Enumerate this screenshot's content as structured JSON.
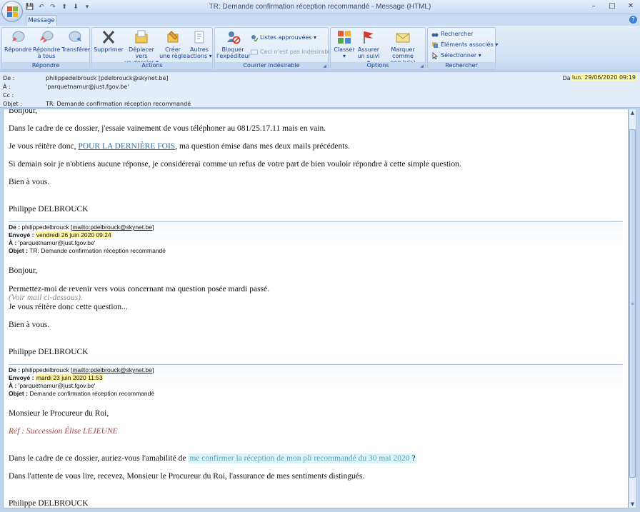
{
  "window": {
    "title": "TR: Demande confirmation réception recommandé - Message (HTML)",
    "minimize": "–",
    "maximize": "□",
    "close": "✕"
  },
  "qat": [
    "💾",
    "↶",
    "↷",
    "⬆",
    "⬇",
    "▾"
  ],
  "tabs": [
    {
      "label": "Message",
      "active": true
    }
  ],
  "ribbon": {
    "groups": {
      "repondre": {
        "label": "Répondre",
        "buttons": [
          {
            "label": "Répondre",
            "label2": ""
          },
          {
            "label": "Répondre",
            "label2": "à tous"
          },
          {
            "label": "Transférer",
            "label2": ""
          }
        ]
      },
      "actions": {
        "label": "Actions",
        "buttons": [
          {
            "label": "Supprimer",
            "label2": ""
          },
          {
            "label": "Déplacer vers",
            "label2": "un dossier ▾"
          },
          {
            "label": "Créer",
            "label2": "une règle"
          },
          {
            "label": "Autres",
            "label2": "actions ▾"
          }
        ]
      },
      "courrier": {
        "label": "Courrier indésirable",
        "bloquer": {
          "label": "Bloquer",
          "label2": "l'expéditeur"
        },
        "listes": "Listes approuvées ▾",
        "pas_indesirable": "Ceci n'est pas indésirable"
      },
      "options": {
        "label": "Options",
        "buttons": [
          {
            "label": "Classer",
            "label2": "▾"
          },
          {
            "label": "Assurer",
            "label2": "un suivi ▾"
          },
          {
            "label": "Marquer comme",
            "label2": "non lu(s)"
          }
        ]
      },
      "rechercher": {
        "label": "Rechercher",
        "items": [
          "Rechercher",
          "Éléments associés ▾",
          "Sélectionner ▾"
        ]
      }
    }
  },
  "header": {
    "from_label": "De :",
    "from_value": "philippedelbrouck [pdelbrouck@skynet.be]",
    "to_label": "À :",
    "to_value": "'parquetnamur@just.fgov.be'",
    "cc_label": "Cc :",
    "cc_value": "",
    "subject_label": "Objet :",
    "subject_value": "TR: Demande confirmation réception recommandé",
    "date_label": "Date :",
    "date_value": "lun. 29/06/2020 09:19"
  },
  "body": {
    "p1": "Bonjour,",
    "p2": "Dans le cadre de ce dossier, j'essaie vainement de vous téléphoner au 081/25.17.11 mais en vain.",
    "p3_a": "Je vous réitère donc, ",
    "p3_link": "POUR LA DERNIÈRE FOIS",
    "p3_b": ", ma question émise dans mes deux mails précédents.",
    "p4": "Si demain soir je n'obtiens aucune réponse, je considérerai comme un refus de votre part de bien vouloir répondre à cette simple question.",
    "p5": "Bien à vous.",
    "sig1": "Philippe DELBROUCK",
    "quote1": {
      "de_label": "De :",
      "de_value": "philippedelbrouck [",
      "de_link": "mailto:pdelbrouck@skynet.be",
      "de_end": "]",
      "envoye_label": "Envoyé :",
      "envoye_value": "vendredi 26 juin 2020 09:24",
      "a_label": "À :",
      "a_value": "'parquetnamur@just.fgov.be'",
      "objet_label": "Objet :",
      "objet_value": "TR: Demande confirmation réception recommandé"
    },
    "q1_p1": "Bonjour,",
    "q1_p2": "Permettez-moi de revenir vers vous concernant ma question posée mardi passé.",
    "q1_p3": "(Voir mail ci-dessous).",
    "q1_p4": "Je vous réitère donc cette question...",
    "q1_p5": "Bien à vous.",
    "sig2": "Philippe DELBROUCK",
    "quote2": {
      "de_label": "De :",
      "de_value": "philippedelbrouck [",
      "de_link": "mailto:pdelbrouck@skynet.be",
      "de_end": "]",
      "envoye_label": "Envoyé :",
      "envoye_value": "mardi 23 juin 2020 11:53",
      "a_label": "À :",
      "a_value": "'parquetnamur@just.fgov.be'",
      "objet_label": "Objet :",
      "objet_value": "Demande confirmation réception recommandé"
    },
    "q2_p1": "Monsieur le Procureur du Roi,",
    "q2_ref": "Réf : Succession Élise LEJEUNE",
    "q2_p2_a": "Dans le cadre de ce dossier, auriez-vous l'amabilité de ",
    "q2_p2_hl": "me confirmer la réception de mon pli recommandé du 30 mai 2020",
    "q2_p2_b": " ?",
    "q2_p3": "Dans l'attente de vous lire, recevez, Monsieur le Procureur du Roi, l'assurance de mes sentiments distingués.",
    "sig3": "Philippe DELBROUCK"
  },
  "scroll": {
    "up": "▲",
    "down": "▼",
    "grip": "≡"
  }
}
